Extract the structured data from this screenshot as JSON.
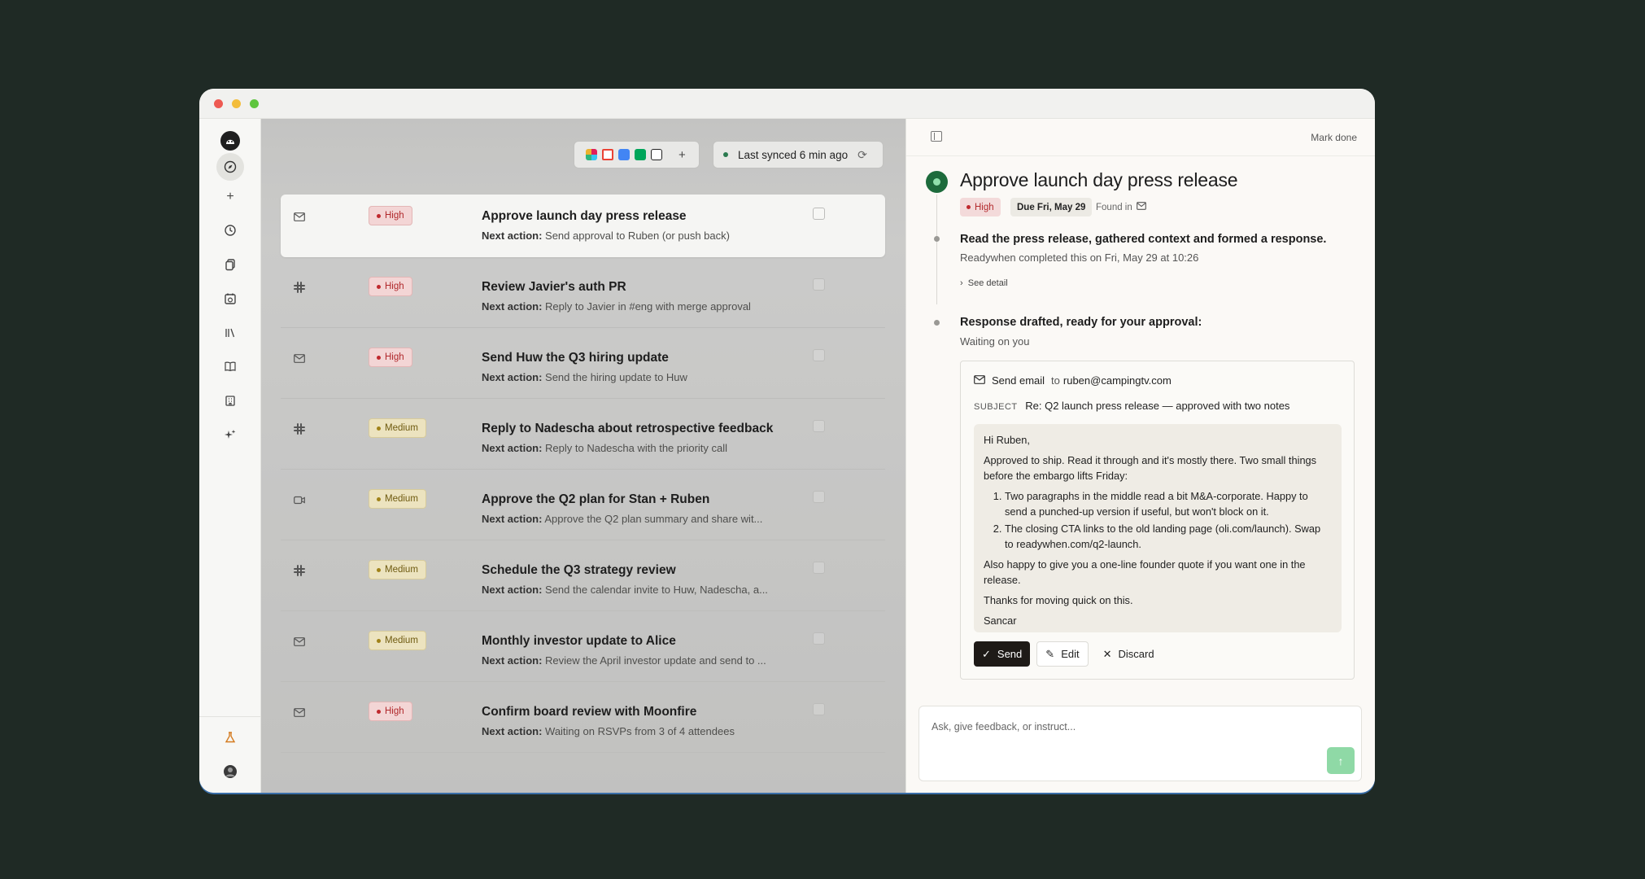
{
  "toolbar": {
    "sync_status": "Last synced 6 min ago",
    "add_label": "+"
  },
  "tasks": [
    {
      "source": "email",
      "priority": "High",
      "title": "Approve launch day press release",
      "next_label": "Next action:",
      "next": "Send approval to Ruben (or push back)"
    },
    {
      "source": "slack",
      "priority": "High",
      "title": "Review Javier's auth PR",
      "next_label": "Next action:",
      "next": "Reply to Javier in #eng with merge approval"
    },
    {
      "source": "email",
      "priority": "High",
      "title": "Send Huw the Q3 hiring update",
      "next_label": "Next action:",
      "next": "Send the hiring update to Huw"
    },
    {
      "source": "slack",
      "priority": "Medium",
      "title": "Reply to Nadescha about retrospective feedback",
      "next_label": "Next action:",
      "next": "Reply to Nadescha with the priority call"
    },
    {
      "source": "meet",
      "priority": "Medium",
      "title": "Approve the Q2 plan for Stan + Ruben",
      "next_label": "Next action:",
      "next": "Approve the Q2 plan summary and share wit..."
    },
    {
      "source": "slack",
      "priority": "Medium",
      "title": "Schedule the Q3 strategy review",
      "next_label": "Next action:",
      "next": "Send the calendar invite to Huw, Nadescha, a..."
    },
    {
      "source": "email",
      "priority": "Medium",
      "title": "Monthly investor update to Alice",
      "next_label": "Next action:",
      "next": "Review the April investor update and send to ..."
    },
    {
      "source": "email",
      "priority": "High",
      "title": "Confirm board review with Moonfire",
      "next_label": "Next action:",
      "next": "Waiting on RSVPs from 3 of 4 attendees"
    }
  ],
  "detail": {
    "mark_done": "Mark done",
    "title": "Approve launch day press release",
    "priority": "High",
    "due": "Due Fri, May 29",
    "found_in": "Found in",
    "step1": {
      "title": "Read the press release, gathered context and formed a response.",
      "sub": "Readywhen completed this on Fri, May 29 at 10:26",
      "see_detail": "See detail"
    },
    "step2": {
      "title": "Response drafted, ready for your approval:",
      "sub": "Waiting on you"
    },
    "email": {
      "action": "Send email",
      "to_label": "to",
      "to": "ruben@campingtv.com",
      "subject_label": "SUBJECT",
      "subject": "Re: Q2 launch press release — approved with two notes",
      "greeting": "Hi Ruben,",
      "para1": "Approved to ship. Read it through and it's mostly there. Two small things before the embargo lifts Friday:",
      "items": [
        "Two paragraphs in the middle read a bit M&A-corporate. Happy to send a punched-up version if useful, but won't block on it.",
        "The closing CTA links to the old landing page (oli.com/launch). Swap to readywhen.com/q2-launch."
      ],
      "para2": "Also happy to give you a one-line founder quote if you want one in the release.",
      "para3": "Thanks for moving quick on this.",
      "signoff": "Sancar"
    },
    "buttons": {
      "send": "Send",
      "edit": "Edit",
      "discard": "Discard"
    },
    "ask_placeholder": "Ask, give feedback, or instruct..."
  },
  "colors": {
    "high": "#c0292e",
    "medium": "#a08218",
    "send_button": "#1e1a17",
    "status_green": "#1d6b3c"
  }
}
